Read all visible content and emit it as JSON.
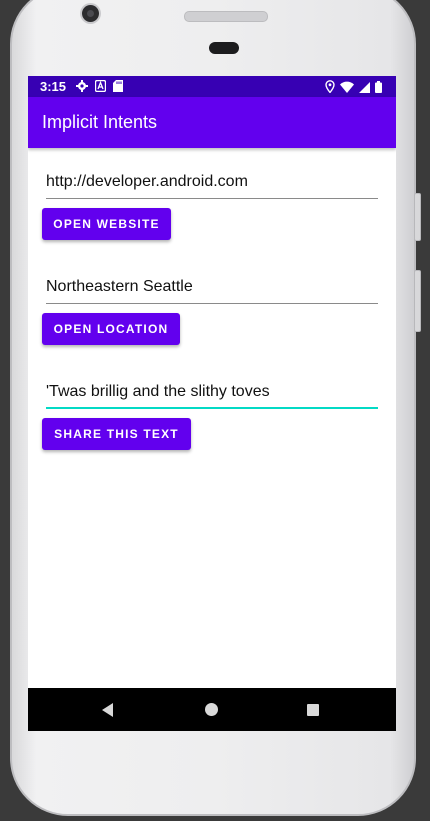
{
  "status_bar": {
    "time": "3:15",
    "left_icons": [
      "gear-icon",
      "a-notification-icon",
      "sd-card-icon"
    ],
    "right_icons": [
      "location-icon",
      "wifi-icon",
      "signal-icon",
      "battery-icon"
    ]
  },
  "app_bar": {
    "title": "Implicit Intents"
  },
  "main": {
    "website_field": {
      "value": "http://developer.android.com"
    },
    "open_website_button": {
      "label": "OPEN WEBSITE"
    },
    "location_field": {
      "value": "Northeastern Seattle"
    },
    "open_location_button": {
      "label": "OPEN LOCATION"
    },
    "share_field": {
      "value": "'Twas brillig and the slithy toves"
    },
    "share_button": {
      "label": "SHARE THIS TEXT"
    }
  },
  "nav_bar": {
    "icons": [
      "back-icon",
      "home-icon",
      "recents-icon"
    ]
  },
  "colors": {
    "status_bar": "#3700b3",
    "primary": "#6200ee",
    "accent": "#03dac5",
    "nav_bar": "#000000"
  }
}
